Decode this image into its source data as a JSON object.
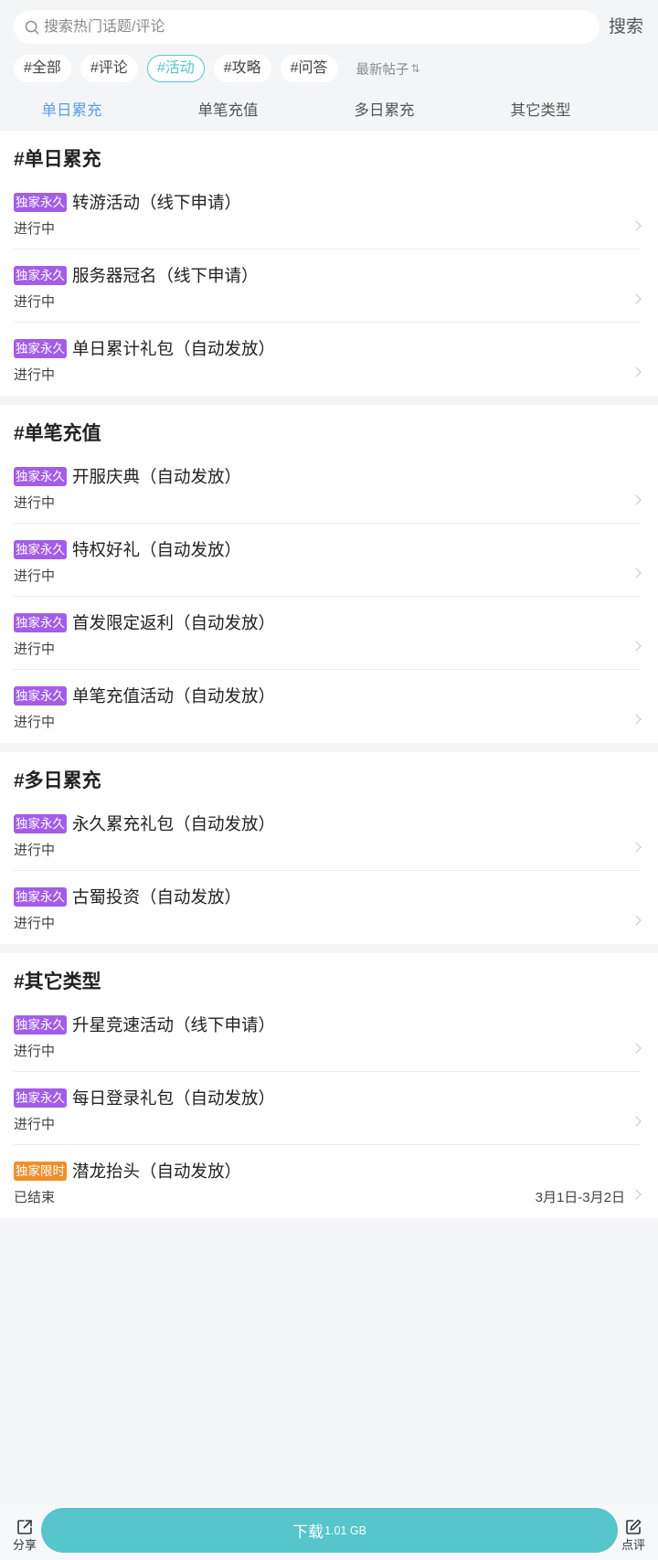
{
  "colors": {
    "page_background": "#f4f5f7",
    "accent_teal": "#56c5cc",
    "tab_active": "#5b9ee8",
    "badge_permanent": "#a35de6",
    "badge_limited": "#ef8f2c"
  },
  "search": {
    "icon": "search-icon",
    "placeholder": "搜索热门话题/评论",
    "button_label": "搜索"
  },
  "filters": {
    "tags": [
      {
        "label": "#全部",
        "active": false
      },
      {
        "label": "#评论",
        "active": false
      },
      {
        "label": "#活动",
        "active": true
      },
      {
        "label": "#攻略",
        "active": false
      },
      {
        "label": "#问答",
        "active": false
      }
    ],
    "sort_label": "最新帖子",
    "sort_icon": "sort-icon"
  },
  "tabs": [
    {
      "label": "单日累充",
      "active": true
    },
    {
      "label": "单笔充值",
      "active": false
    },
    {
      "label": "多日累充",
      "active": false
    },
    {
      "label": "其它类型",
      "active": false
    }
  ],
  "sections": [
    {
      "title": "#单日累充",
      "items": [
        {
          "badge": "独家永久",
          "badge_color": "#a35de6",
          "title": "转游活动（线下申请）",
          "status": "进行中"
        },
        {
          "badge": "独家永久",
          "badge_color": "#a35de6",
          "title": "服务器冠名（线下申请）",
          "status": "进行中"
        },
        {
          "badge": "独家永久",
          "badge_color": "#a35de6",
          "title": "单日累计礼包（自动发放）",
          "status": "进行中"
        }
      ]
    },
    {
      "title": "#单笔充值",
      "items": [
        {
          "badge": "独家永久",
          "badge_color": "#a35de6",
          "title": "开服庆典（自动发放）",
          "status": "进行中"
        },
        {
          "badge": "独家永久",
          "badge_color": "#a35de6",
          "title": "特权好礼（自动发放）",
          "status": "进行中"
        },
        {
          "badge": "独家永久",
          "badge_color": "#a35de6",
          "title": "首发限定返利（自动发放）",
          "status": "进行中"
        },
        {
          "badge": "独家永久",
          "badge_color": "#a35de6",
          "title": "单笔充值活动（自动发放）",
          "status": "进行中"
        }
      ]
    },
    {
      "title": "#多日累充",
      "items": [
        {
          "badge": "独家永久",
          "badge_color": "#a35de6",
          "title": "永久累充礼包（自动发放）",
          "status": "进行中"
        },
        {
          "badge": "独家永久",
          "badge_color": "#a35de6",
          "title": "古蜀投资（自动发放）",
          "status": "进行中"
        }
      ]
    },
    {
      "title": "#其它类型",
      "items": [
        {
          "badge": "独家永久",
          "badge_color": "#a35de6",
          "title": "升星竞速活动（线下申请）",
          "status": "进行中"
        },
        {
          "badge": "独家永久",
          "badge_color": "#a35de6",
          "title": "每日登录礼包（自动发放）",
          "status": "进行中"
        },
        {
          "badge": "独家限时",
          "badge_color": "#ef8f2c",
          "title": "潜龙抬头（自动发放）",
          "status": "已结束",
          "date": "3月1日-3月2日"
        }
      ]
    }
  ],
  "bottom_bar": {
    "share_icon": "share-icon",
    "share_label": "分享",
    "download_label": "下载",
    "download_size": "1.01 GB",
    "review_icon": "edit-icon",
    "review_label": "点评"
  }
}
